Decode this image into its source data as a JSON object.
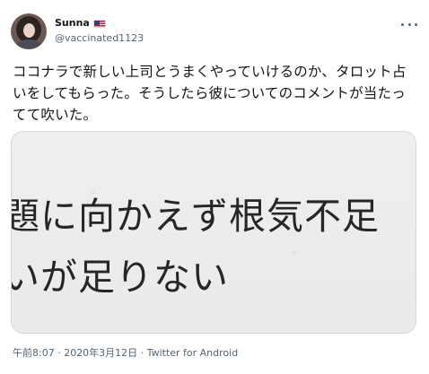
{
  "user": {
    "name": "Sunna",
    "flag_icon": "us-flag-icon",
    "handle": "@vaccinated1123"
  },
  "tweet": {
    "text": "ココナラで新しい上司とうまくやっていけるのか、タロット占いをしてもらった。そうしたら彼についてのコメントが当たってて吹いた。",
    "more_icon": "more-horizontal-icon"
  },
  "media": {
    "line1": "題に向かえず根気不足",
    "line2": "いが足りない"
  },
  "meta": {
    "timestamp_source": "午前8:07 · 2020年3月12日 · Twitter for Android"
  }
}
